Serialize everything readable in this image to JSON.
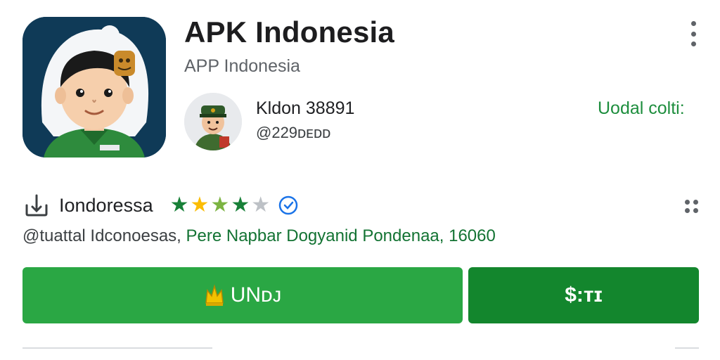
{
  "app": {
    "title": "APK Indonesia",
    "subtitle": "APP Indonesia",
    "icon": "cartoon-boy-headscarf-icon"
  },
  "developer": {
    "name": "Kldon 38891",
    "handle": "@229ᴅᴇᴅᴅ",
    "avatar": "cartoon-officer-avatar"
  },
  "install_link": "Uodal colti:",
  "rating": {
    "name": "Iondoressa",
    "stars": 4,
    "max_stars": 5,
    "star_colors": [
      "#188038",
      "#fbbc04",
      "#7cb342",
      "#188038",
      "#bdc1c6"
    ],
    "verified_icon": "verified-icon"
  },
  "meta": {
    "gray_part": "@tuattal Idconoesas, ",
    "green_part": "Pere Napbar Dogyanid Pondenaa, 16060"
  },
  "buttons": {
    "primary_label": "UNᴅᴊ",
    "primary_icon": "crown-icon",
    "secondary_label": "$:ᴛɪ"
  },
  "colors": {
    "primary_button": "#2aa744",
    "secondary_button": "#13862d",
    "accent_green": "#1e8e3e",
    "icon_background": "#0f3a57"
  }
}
